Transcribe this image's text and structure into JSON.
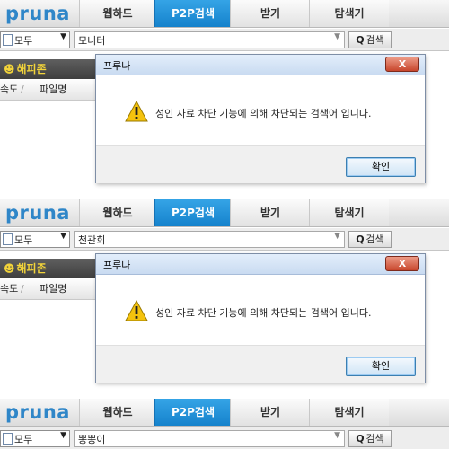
{
  "logo": "pruna",
  "tabs": [
    {
      "label": "웹하드",
      "active": false
    },
    {
      "label": "P2P검색",
      "active": true
    },
    {
      "label": "받기",
      "active": false
    },
    {
      "label": "탐색기",
      "active": false
    }
  ],
  "search": {
    "category": "모두",
    "button_label": "검색",
    "button_icon": "magnifier-icon"
  },
  "sidebar": {
    "zone_title": "해피존",
    "zone_icon": "smiley-icon",
    "col_speed": "속도",
    "col_sep": "/",
    "col_filename": "파일명"
  },
  "dialog": {
    "title": "프루나",
    "message": "성인 자료 차단 기능에 의해 차단되는 검색어 입니다.",
    "ok_label": "확인",
    "close_label": "X",
    "icon": "warning-icon"
  },
  "panels": [
    {
      "query": "모니터",
      "has_dialog": true
    },
    {
      "query": "천관희",
      "has_dialog": true
    },
    {
      "query": "뽕뽕이",
      "has_dialog": false
    }
  ],
  "colors": {
    "brand": "#2f86c8",
    "active_tab": "#1d8ed6",
    "zone_text": "#f3d43a"
  }
}
